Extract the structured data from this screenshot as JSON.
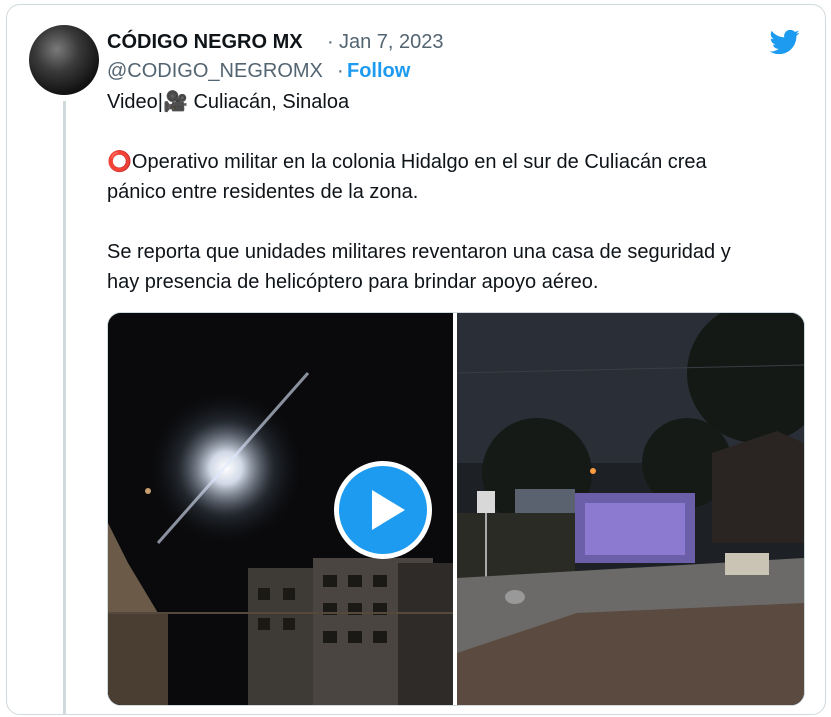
{
  "tweet": {
    "author_name": "CÓDIGO NEGRO MX",
    "separator": "·",
    "date": "Jan 7, 2023",
    "handle": "@CODIGO_NEGROMX",
    "follow_label": "Follow",
    "lines": [
      "Video|🎥 Culiacán, Sinaloa",
      "⭕Operativo militar en la colonia Hidalgo en el sur de Culiacán crea",
      "pánico entre residentes de la zona.",
      "Se reporta que unidades militares reventaron una casa de seguridad y",
      "hay presencia de helicóptero para brindar apoyo aéreo."
    ]
  },
  "icons": {
    "brand": "twitter-bird-icon",
    "play": "play-icon"
  },
  "colors": {
    "accent": "#1d9bf0",
    "text": "#0f1419",
    "muted": "#536471",
    "border": "#cfd9de"
  }
}
